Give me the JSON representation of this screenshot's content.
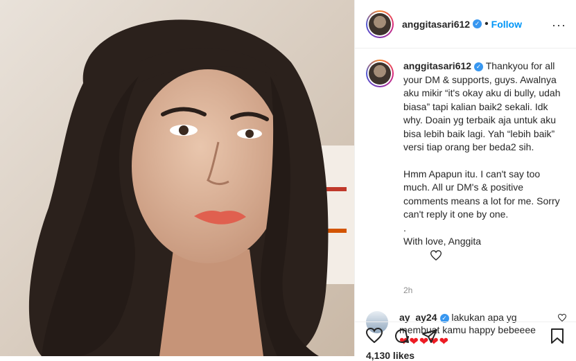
{
  "header": {
    "username": "anggitasari612",
    "follow_label": "Follow",
    "separator": "•",
    "more": "···"
  },
  "caption": {
    "username": "anggitasari612",
    "paragraph1": "Thankyou for all your DM & supports, guys. Awalnya aku mikir “it's okay aku di bully, udah biasa” tapi kalian baik2 sekali. Idk why. Doain yg terbaik aja untuk aku bisa lebih baik lagi. Yah “lebih baik” versi tiap orang ber beda2 sih.",
    "paragraph2": "Hmm Apapun itu. I can't say too much. All ur DM's & positive comments means a lot for me. Sorry can't reply it one by one.",
    "dot_line": ".",
    "signoff": "With love, Anggita",
    "time": "2h"
  },
  "comment": {
    "username": "ay_ay24",
    "text": "lakukan apa yg membuat kamu happy bebeeee",
    "hearts": "❤❤❤❤❤"
  },
  "footer": {
    "likes": "4,130 likes"
  },
  "icons": [
    "heart-icon",
    "comment-icon",
    "share-icon",
    "bookmark-icon",
    "verified-icon",
    "heart-outline-icon"
  ],
  "colors": {
    "follow": "#0095f6",
    "verified": "#3897f0",
    "heart": "#ed1c24"
  }
}
